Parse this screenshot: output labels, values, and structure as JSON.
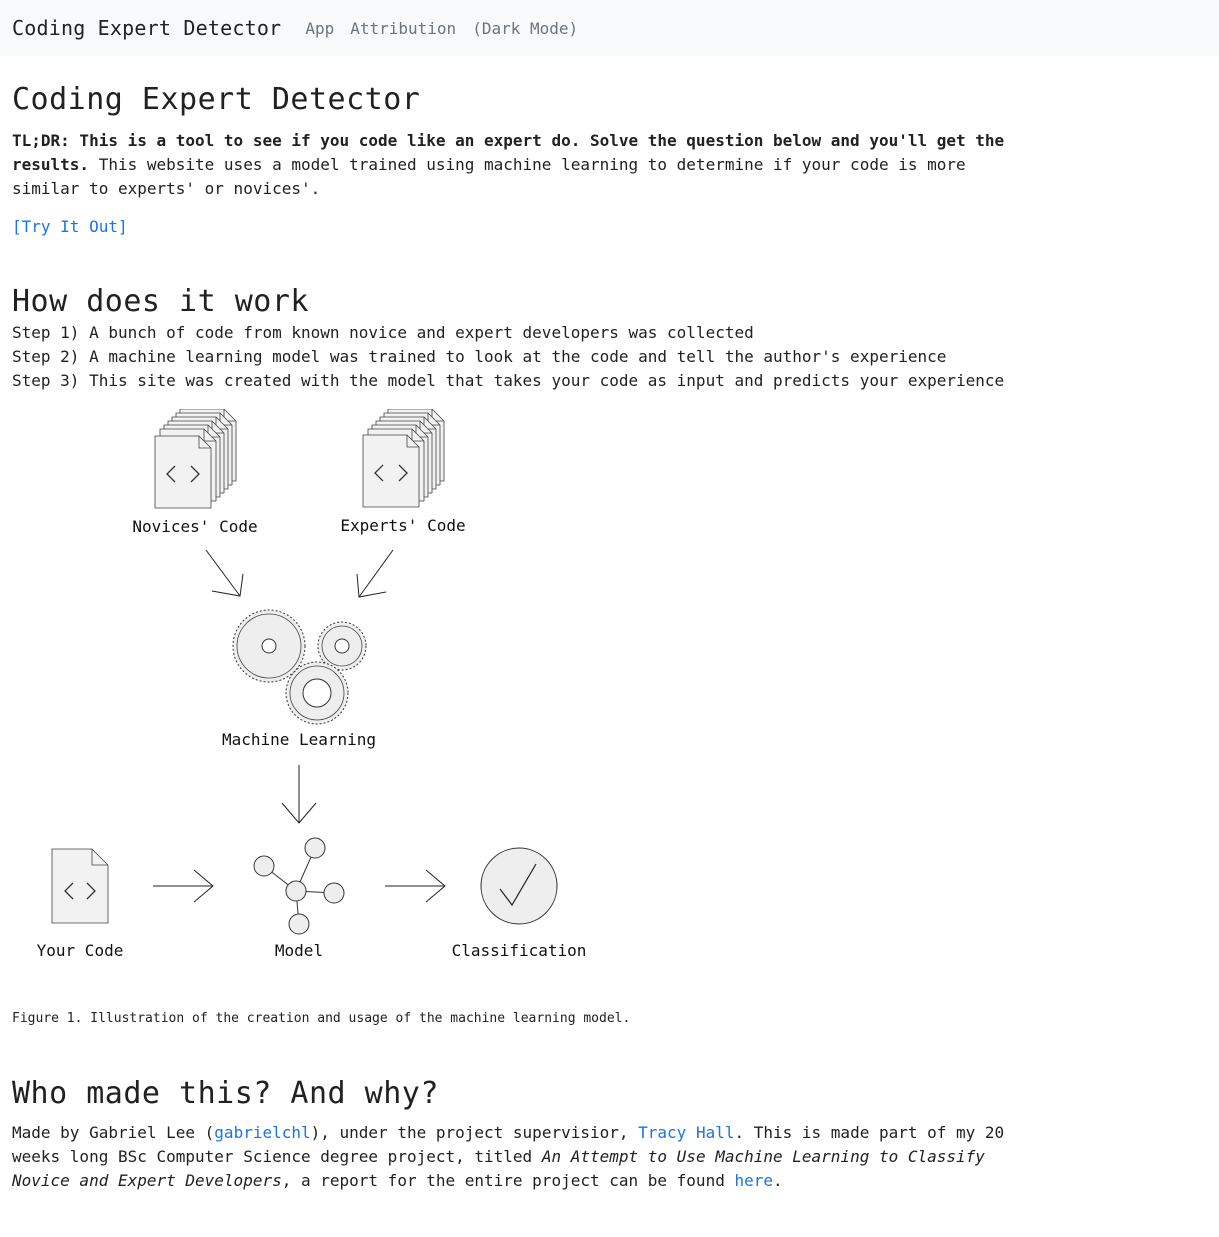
{
  "nav": {
    "brand": "Coding Expert Detector",
    "links": [
      "App",
      "Attribution",
      "(Dark Mode)"
    ]
  },
  "main": {
    "title": "Coding Expert Detector",
    "tldr_bold": "TL;DR: This is a tool to see if you code like an expert do. Solve the question below and you'll get the results.",
    "tldr_rest": " This website uses a model trained using machine learning to determine if your code is more similar to experts' or novices'.",
    "try_link": "[Try It Out]"
  },
  "how": {
    "heading": "How does it work",
    "steps": [
      "Step 1) A bunch of code from known novice and expert developers was collected",
      "Step 2) A machine learning model was trained to look at the code and tell the author's experience",
      "Step 3) This site was created with the model that takes your code as input and predicts your experience"
    ]
  },
  "figure": {
    "labels": {
      "novices": "Novices' Code",
      "experts": "Experts' Code",
      "ml": "Machine Learning",
      "your_code": "Your Code",
      "model": "Model",
      "classification": "Classification"
    },
    "caption": "Figure 1. Illustration of the creation and usage of the machine learning model."
  },
  "who": {
    "heading": "Who made this? And why?",
    "t1": "Made by Gabriel Lee (",
    "link_user": "gabrielchl",
    "t2": "), under the project supervisior, ",
    "link_supervisor": "Tracy Hall",
    "t3": ". This is made part of my 20 weeks long BSc Computer Science degree project, titled ",
    "italic_title": "An Attempt to Use Machine Learning to Classify Novice and Expert Developers",
    "t4": ", a report for the entire project can be found ",
    "link_here": "here",
    "t5": "."
  },
  "colors": {
    "link": "#1a73e8",
    "navbar_bg": "#f8f9fa",
    "nav_link": "#6c757d"
  }
}
